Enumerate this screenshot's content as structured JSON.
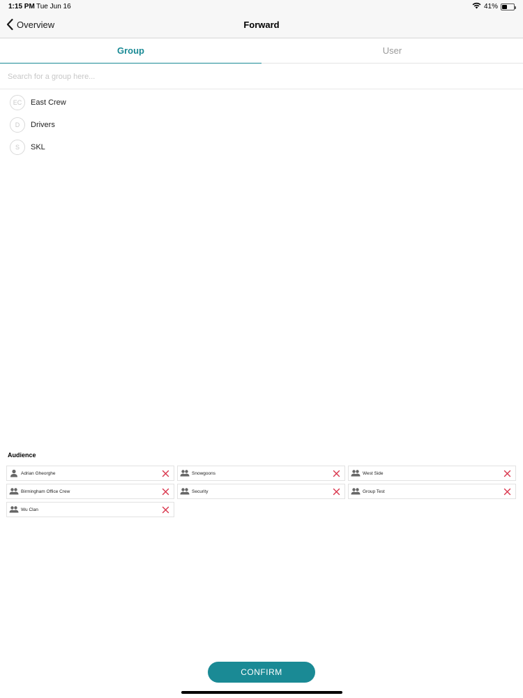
{
  "status_bar": {
    "time": "1:15 PM",
    "date": "Tue Jun 16",
    "battery_text": "41%",
    "battery_level": 0.41,
    "icons": [
      "wifi-icon",
      "battery-icon"
    ]
  },
  "nav": {
    "back_label": "Overview",
    "title": "Forward"
  },
  "tabs": [
    {
      "label": "Group",
      "active": true
    },
    {
      "label": "User",
      "active": false
    }
  ],
  "search": {
    "placeholder": "Search for a group here...",
    "value": ""
  },
  "groups": [
    {
      "initials": "EC",
      "name": "East Crew"
    },
    {
      "initials": "D",
      "name": "Drivers"
    },
    {
      "initials": "S",
      "name": "SKL"
    }
  ],
  "audience": {
    "title": "Audience",
    "items": [
      {
        "name": "Adrian Gheorghe",
        "type": "user"
      },
      {
        "name": "Snowgoons",
        "type": "group"
      },
      {
        "name": "West Side",
        "type": "group"
      },
      {
        "name": "Birmingham Office Crew",
        "type": "group"
      },
      {
        "name": "Security",
        "type": "group"
      },
      {
        "name": "Group Test",
        "type": "group"
      },
      {
        "name": "Wu Clan",
        "type": "group"
      }
    ]
  },
  "confirm_label": "CONFIRM",
  "colors": {
    "accent": "#1a8a95",
    "remove": "#d9354c"
  }
}
